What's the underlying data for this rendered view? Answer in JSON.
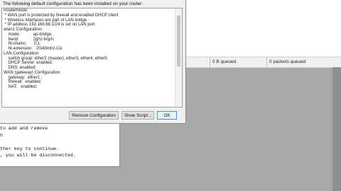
{
  "dialog": {
    "title": "The following default configuration has been installed on your router:",
    "lines": [
      "RouterMode:",
      " * WAN port is protected by firewall and enabled DHCP client",
      " * Wireless interfaces are part of LAN bridge",
      " * IP address 192.168.88.1/24 is set on LAN port",
      "wlan1 Configuration:",
      "    mode:           ap-bridge;",
      "    band:            2ghz-b/g/n;",
      "    ht-chains:      0,1;",
      "    ht-extension:   20/40mhz-Ce;",
      "LAN Configuration:",
      "    switch group: ether2 (master), ether3, ether4, ether5",
      "    DHCP Server: enabled;",
      "    DNS: enabled;",
      "WAN (gateway) Configuration:",
      "    gateway:  ether1 ;",
      "    firewall:  enabled;",
      "    NAT:   enabled;",
      "",
      "",
      "",
      ""
    ],
    "buttons": {
      "remove": "Remove Configuration",
      "show_script": "Show Script...",
      "ok": "OK"
    }
  },
  "status_bar": {
    "queued_bytes": "0 B queued",
    "queued_packets": "0 packets queued"
  },
  "terminal": {
    "lines": [
      "to add and remove",
      "h",
      "",
      "ther key to continue.",
      ", you will be disconnected."
    ]
  }
}
